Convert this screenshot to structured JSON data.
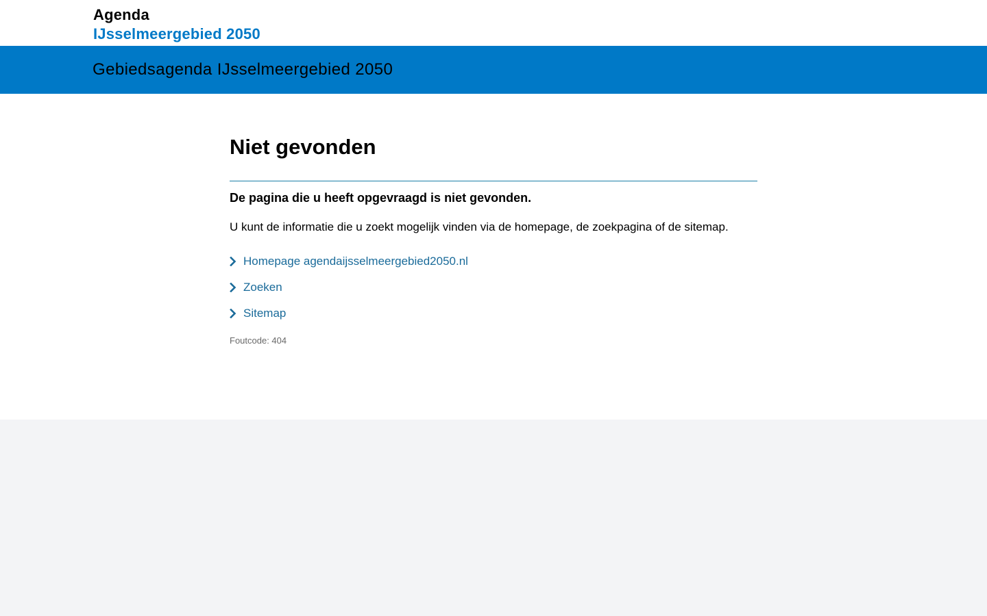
{
  "header": {
    "logo_line1": "Agenda",
    "logo_line2": "IJsselmeergebied 2050"
  },
  "banner": {
    "title": "Gebiedsagenda IJsselmeergebied 2050"
  },
  "main": {
    "title": "Niet gevonden",
    "lead": "De pagina die u heeft opgevraagd is niet gevonden.",
    "body": "U kunt de informatie die u zoekt mogelijk vinden via de homepage, de zoekpagina of de sitemap.",
    "links": [
      {
        "label": "Homepage agendaijsselmeergebied2050.nl",
        "icon": "chevron-right-icon"
      },
      {
        "label": "Zoeken",
        "icon": "chevron-right-icon"
      },
      {
        "label": "Sitemap",
        "icon": "chevron-right-icon"
      }
    ],
    "error_code": "Foutcode: 404"
  },
  "colors": {
    "brand_blue": "#0079c7",
    "link": "#1a6b9a",
    "footer_bg": "#f3f4f6"
  }
}
